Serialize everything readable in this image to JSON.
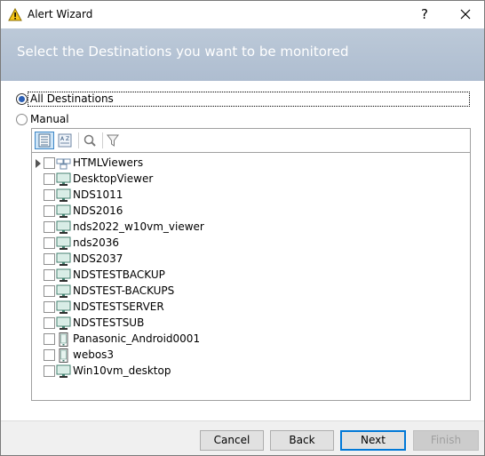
{
  "window": {
    "title": "Alert Wizard",
    "help_label": "?"
  },
  "banner": {
    "text": "Select the Destinations you want to be monitored"
  },
  "options": {
    "all": {
      "label": "All Destinations",
      "checked": true
    },
    "manual": {
      "label": "Manual",
      "checked": false
    }
  },
  "toolbar": {
    "buttons": [
      "list-view-icon",
      "sort-az-icon",
      "search-icon",
      "filter-icon"
    ]
  },
  "tree": {
    "items": [
      {
        "label": "HTMLViewers",
        "icon": "group-icon",
        "expandable": true
      },
      {
        "label": "DesktopViewer",
        "icon": "monitor-icon"
      },
      {
        "label": "NDS1011",
        "icon": "monitor-icon"
      },
      {
        "label": "NDS2016",
        "icon": "monitor-icon"
      },
      {
        "label": "nds2022_w10vm_viewer",
        "icon": "monitor-icon"
      },
      {
        "label": "nds2036",
        "icon": "monitor-icon"
      },
      {
        "label": "NDS2037",
        "icon": "monitor-icon"
      },
      {
        "label": "NDSTESTBACKUP",
        "icon": "monitor-icon"
      },
      {
        "label": "NDSTEST-BACKUPS",
        "icon": "monitor-icon"
      },
      {
        "label": "NDSTESTSERVER",
        "icon": "monitor-icon"
      },
      {
        "label": "NDSTESTSUB",
        "icon": "monitor-icon"
      },
      {
        "label": "Panasonic_Android0001",
        "icon": "mobile-icon"
      },
      {
        "label": "webos3",
        "icon": "mobile-icon"
      },
      {
        "label": "Win10vm_desktop",
        "icon": "monitor-icon"
      }
    ]
  },
  "footer": {
    "cancel_label": "Cancel",
    "back_label": "Back",
    "next_label": "Next",
    "finish_label": "Finish"
  },
  "colors": {
    "banner": "#b4c3d5",
    "accent": "#0078d7",
    "radio_selected": "#2b5fb5"
  }
}
